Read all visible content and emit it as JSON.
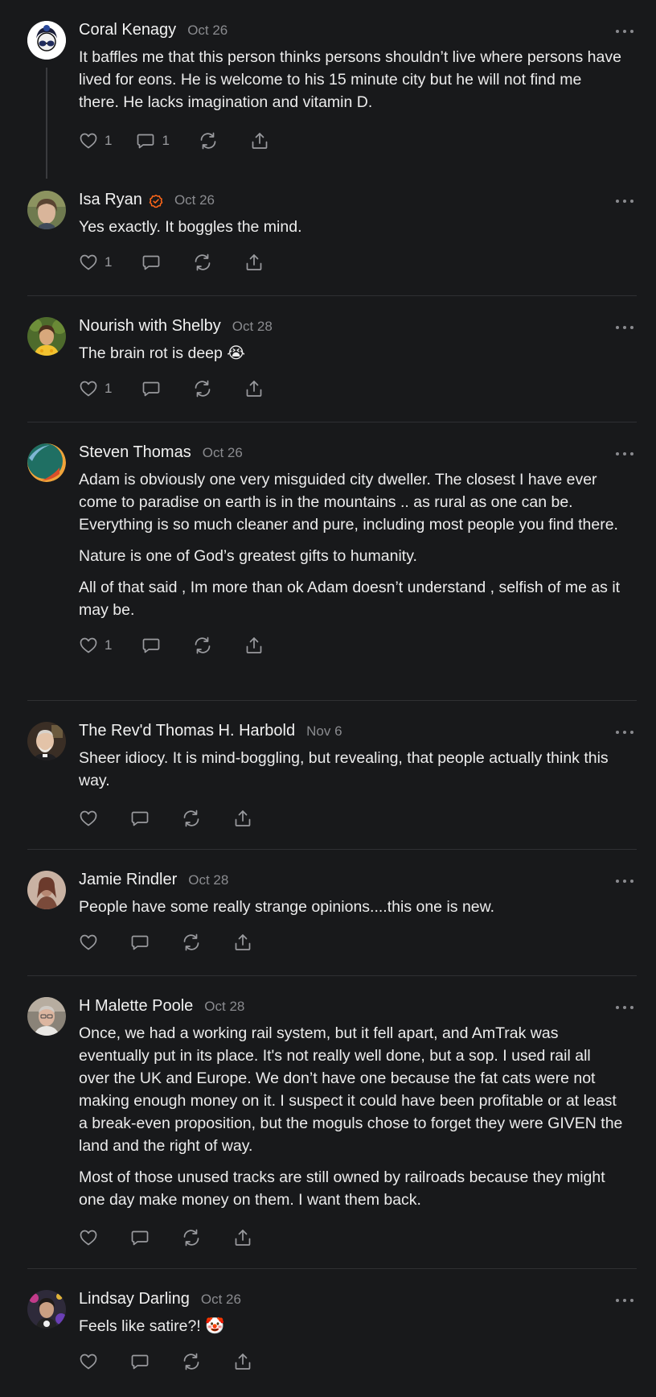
{
  "comments": [
    {
      "name": "Coral Kenagy",
      "date": "Oct 26",
      "paragraphs": [
        "It baffles me that this person thinks persons shouldn’t live where persons have lived for eons. He is welcome to his 15 minute city but he will not find me there. He lacks imagination and vitamin D."
      ],
      "likes": "1",
      "replies": "1"
    },
    {
      "name": "Isa Ryan",
      "date": "Oct 26",
      "verified": true,
      "paragraphs": [
        "Yes exactly. It boggles the mind."
      ],
      "likes": "1"
    },
    {
      "name": "Nourish with Shelby",
      "date": "Oct 28",
      "paragraphs": [
        "The brain rot is deep 😭"
      ],
      "likes": "1"
    },
    {
      "name": "Steven Thomas",
      "date": "Oct 26",
      "paragraphs": [
        "Adam is obviously one very misguided city dweller. The closest I have ever come to paradise on earth is in the mountains .. as rural as one can be. Everything is so much cleaner and pure, including most people you find there.",
        "Nature is one of God’s greatest gifts to humanity.",
        "All of that said , Im more than ok Adam doesn’t understand , selfish of me as it may be."
      ],
      "likes": "1"
    },
    {
      "name": "The Rev'd Thomas H. Harbold",
      "date": "Nov 6",
      "paragraphs": [
        "Sheer idiocy. It is mind-boggling, but revealing, that people actually think this way."
      ]
    },
    {
      "name": "Jamie Rindler",
      "date": "Oct 28",
      "paragraphs": [
        "People have some really strange opinions....this one is new."
      ]
    },
    {
      "name": "H Malette Poole",
      "date": "Oct 28",
      "paragraphs": [
        "Once, we had a working rail system, but it fell apart, and AmTrak was eventually put in its place. It's not really well done, but a sop. I used rail all over the UK and Europe. We don’t have one because the fat cats were not making enough money on it. I suspect it could have been profitable or at least a break-even proposition, but the moguls chose to forget they were GIVEN the land and the right of way.",
        "Most of those unused tracks are still owned by railroads because they might one day make money on them. I want them back."
      ]
    },
    {
      "name": "Lindsay Darling",
      "date": "Oct 26",
      "paragraphs": [
        "Feels like satire?! 🤡"
      ]
    }
  ],
  "colors": {
    "background": "#18191b",
    "text": "#ececec",
    "muted": "#8a8b8f",
    "verified": "#ff6719"
  },
  "icons": [
    "heart-icon",
    "comment-icon",
    "restack-icon",
    "share-icon",
    "more-icon",
    "verified-icon"
  ]
}
